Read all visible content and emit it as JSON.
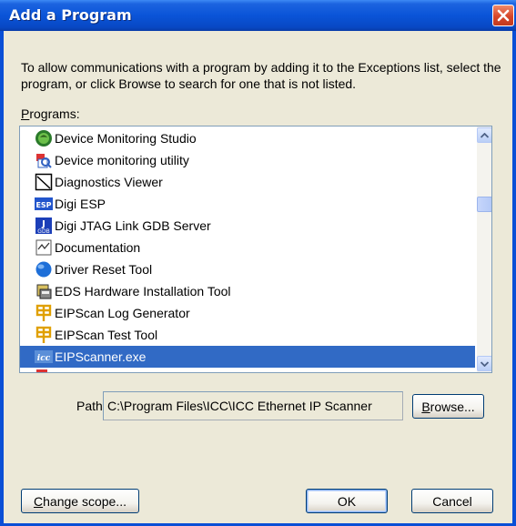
{
  "window": {
    "title": "Add a Program"
  },
  "description": "To allow communications with a program by adding it to the Exceptions list, select the program, or click Browse to search for one that is not listed.",
  "programs": {
    "label_underlined": "P",
    "label_rest": "rograms:",
    "items": [
      {
        "label": "Device Monitoring Studio",
        "icon": "green-globe-icon"
      },
      {
        "label": "Device monitoring utility",
        "icon": "monitor-magnifier-icon"
      },
      {
        "label": "Diagnostics Viewer",
        "icon": "diagnostics-chart-icon"
      },
      {
        "label": "Digi ESP",
        "icon": "esp-icon"
      },
      {
        "label": "Digi JTAG Link GDB Server",
        "icon": "jtag-gdb-icon"
      },
      {
        "label": "Documentation",
        "icon": "document-icon"
      },
      {
        "label": "Driver Reset Tool",
        "icon": "blue-globe-icon"
      },
      {
        "label": "EDS Hardware Installation Tool",
        "icon": "installer-icon"
      },
      {
        "label": "EIPScan Log Generator",
        "icon": "eipscan-icon"
      },
      {
        "label": "EIPScan Test Tool",
        "icon": "eipscan-icon"
      },
      {
        "label": "EIPScanner.exe",
        "icon": "icc-icon",
        "selected": true
      }
    ]
  },
  "path": {
    "label": "Path:",
    "value": "C:\\Program Files\\ICC\\ICC Ethernet IP Scanner"
  },
  "buttons": {
    "browse_underlined": "B",
    "browse_rest": "rowse...",
    "change_scope_underlined": "C",
    "change_scope_rest": "hange scope...",
    "ok": "OK",
    "cancel": "Cancel"
  }
}
